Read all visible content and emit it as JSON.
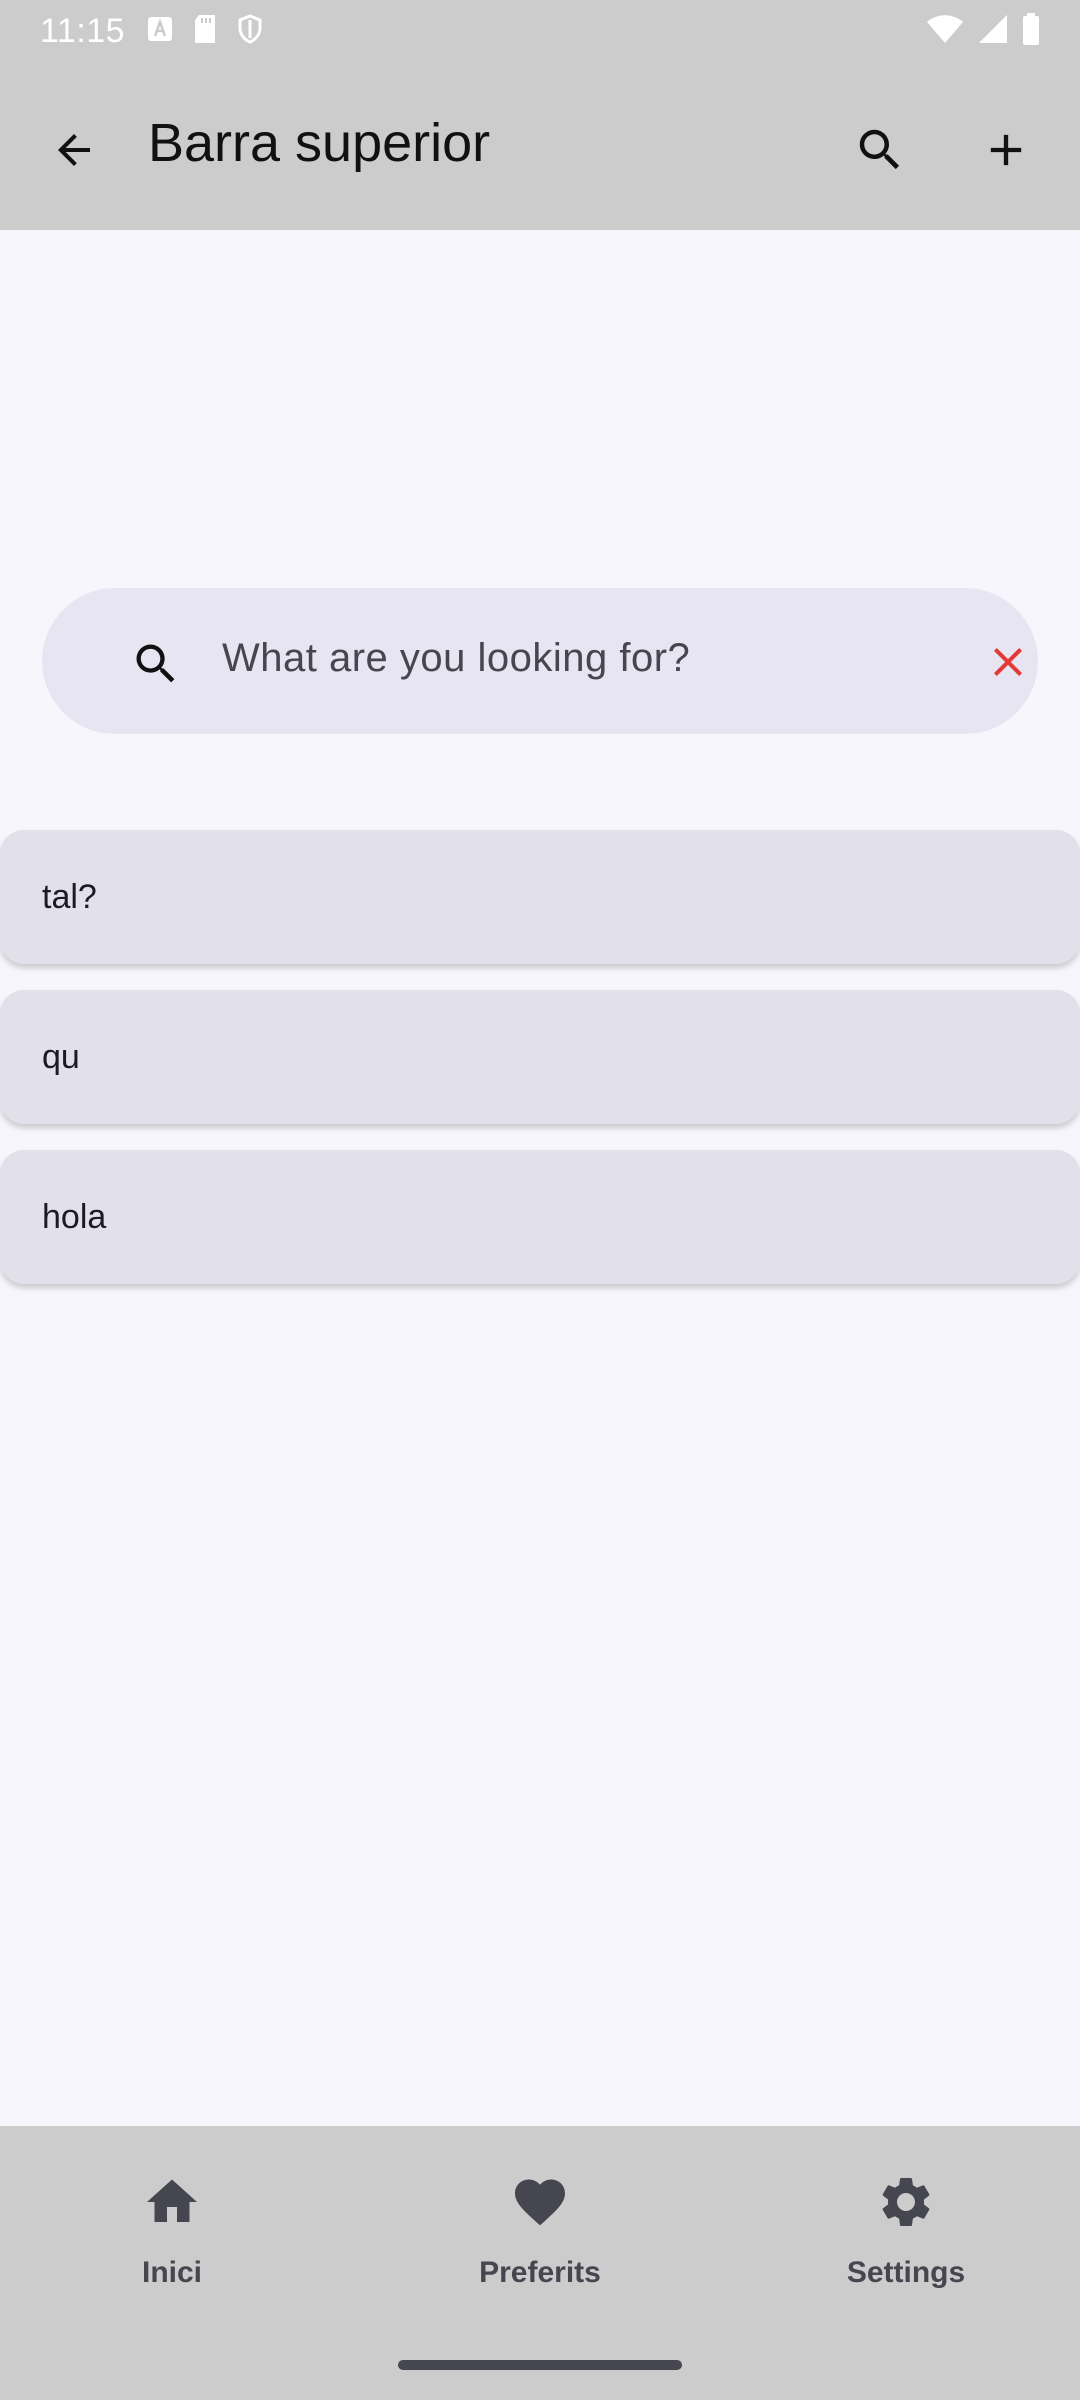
{
  "status_bar": {
    "time": "11:15",
    "left_icons": [
      "font-icon",
      "sd-card-icon",
      "shield-icon"
    ],
    "right_icons": [
      "wifi-icon",
      "signal-icon",
      "battery-icon"
    ]
  },
  "app_bar": {
    "title": "Barra superior",
    "back_icon": "arrow-back-icon",
    "actions": [
      "search-icon",
      "add-icon"
    ]
  },
  "search": {
    "placeholder": "What are you looking for?",
    "value": "",
    "clear_icon": "close-icon"
  },
  "history_items": [
    "tal?",
    "qu",
    "hola"
  ],
  "bottom_nav": {
    "items": [
      {
        "label": "Inici",
        "icon": "home-icon"
      },
      {
        "label": "Preferits",
        "icon": "heart-icon"
      },
      {
        "label": "Settings",
        "icon": "gear-icon"
      }
    ]
  },
  "colors": {
    "bar_bg": "#cccccc",
    "page_bg": "#f7f6fc",
    "search_bg": "#e6e5f1",
    "item_bg": "#e2e1eb",
    "clear_icon": "#e53935"
  }
}
